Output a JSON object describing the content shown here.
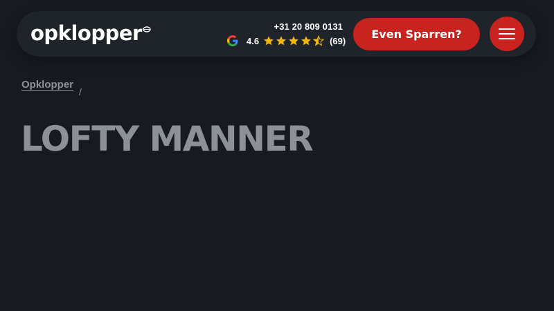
{
  "header": {
    "logo_text": "opklopper",
    "phone": "+31 20 809 0131",
    "rating": {
      "source_icon": "google-icon",
      "value": "4.6",
      "stars": 4.5,
      "max_stars": 5,
      "count": "(69)"
    },
    "cta_label": "Even Sparren?",
    "menu_icon": "hamburger-menu-icon"
  },
  "breadcrumb": {
    "items": [
      {
        "label": "Opklopper"
      }
    ],
    "separator": "/"
  },
  "main": {
    "title": "LOFTY MANNER"
  },
  "colors": {
    "background": "#171b20",
    "header_bar": "#1f242a",
    "accent": "#c8231f",
    "muted_text": "#8c9197",
    "star": "#f5b50a"
  }
}
